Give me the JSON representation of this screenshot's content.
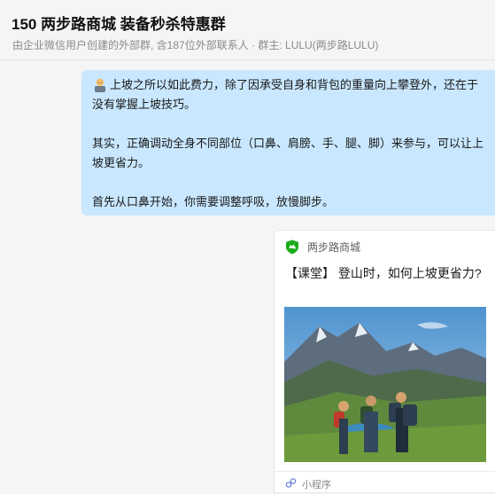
{
  "header": {
    "title": "150 两步路商城 装备秒杀特惠群",
    "subtitle": "由企业微信用户创建的外部群, 含187位外部联系人 · 群主: LULU(两步路LULU)"
  },
  "message": {
    "emoji_icon": "person-icon",
    "paragraph1": "上坡之所以如此费力，除了因承受自身和背包的重量向上攀登外，还在于没有掌握上坡技巧。",
    "paragraph2": "其实，正确调动全身不同部位（口鼻、肩膀、手、腿、脚）来参与，可以让上坡更省力。",
    "paragraph3": "首先从口鼻开始，你需要调整呼吸，放慢脚步。"
  },
  "card": {
    "brand_icon": "shield-logo-icon",
    "brand_name": "两步路商城",
    "title": "【课堂】 登山时，如何上坡更省力?",
    "footer_icon": "mini-program-icon",
    "footer_label": "小程序"
  },
  "colors": {
    "bubble": "#c9e7ff",
    "brand_green": "#1aad19",
    "background": "#f5f5f5"
  }
}
